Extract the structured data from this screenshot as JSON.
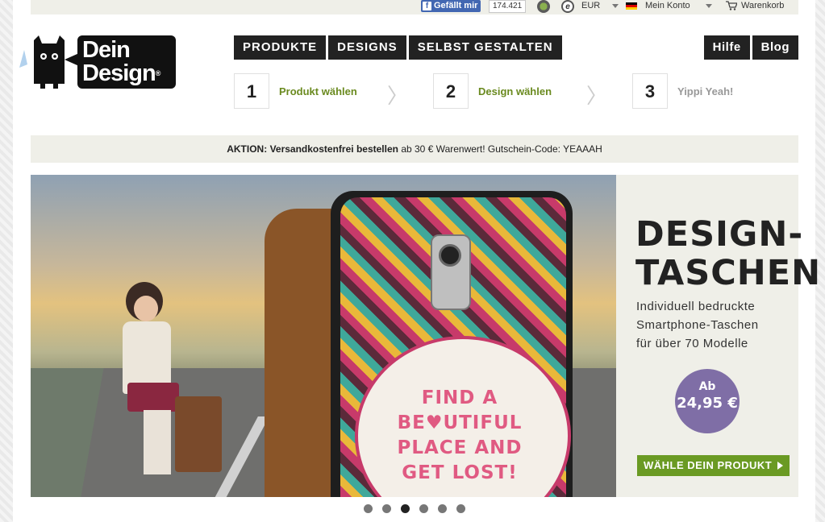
{
  "topbar": {
    "fb_like_label": "Gefällt mir",
    "fb_count": "174.421",
    "currency": "EUR",
    "account_label": "Mein Konto",
    "cart_label": "Warenkorb"
  },
  "logo": {
    "line1": "Dein",
    "line2": "Design"
  },
  "nav": {
    "items": [
      "PRODUKTE",
      "DESIGNS",
      "SELBST GESTALTEN"
    ],
    "right_items": [
      "Hilfe",
      "Blog"
    ]
  },
  "steps": [
    {
      "num": "1",
      "label": "Produkt wählen"
    },
    {
      "num": "2",
      "label": "Design wählen"
    },
    {
      "num": "3",
      "label": "Yippi Yeah!"
    }
  ],
  "promo": {
    "prefix": "AKTION:",
    "bold": "Versandkostenfrei bestellen",
    "rest": "ab 30 € Warenwert! Gutschein-Code: YEAAAH"
  },
  "hero": {
    "case_quote": "FIND A\nBE♥UTIFUL\nPLACE AND\nGET LOST!",
    "title": "DESIGN-\nTASCHEN",
    "subtitle": "Individuell bedruckte\nSmartphone-Taschen\nfür über 70 Modelle",
    "price_prefix": "Ab",
    "price": "24,95 €",
    "cta_label": "WÄHLE DEIN PRODUKT"
  },
  "pager": {
    "count": 6,
    "active_index": 2
  },
  "colors": {
    "accent_green": "#6a9a23",
    "price_purple": "#7f6ea6",
    "nav_dark": "#222222",
    "panel_beige": "#efefe8"
  }
}
